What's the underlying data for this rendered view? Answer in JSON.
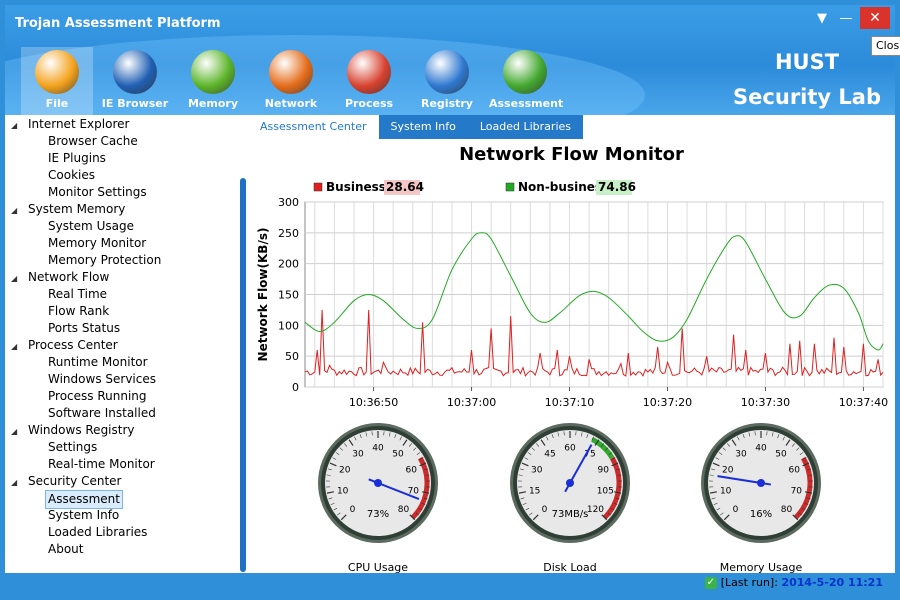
{
  "app": {
    "title": "Trojan Assessment Platform",
    "brand_line1": "HUST",
    "brand_line2": "Security Lab",
    "close_tooltip": "Clos"
  },
  "nav": [
    {
      "label": "File",
      "icon": "file-folder-icon",
      "color": "#f4a21c"
    },
    {
      "label": "IE Browser",
      "icon": "monitor-icon",
      "color": "#1f5fb3"
    },
    {
      "label": "Memory",
      "icon": "up-arrows-icon",
      "color": "#5cb52a"
    },
    {
      "label": "Network",
      "icon": "refresh-arrows-icon",
      "color": "#e46c1a"
    },
    {
      "label": "Process",
      "icon": "windows-tiles-icon",
      "color": "#d8422f"
    },
    {
      "label": "Registry",
      "icon": "shield-target-icon",
      "color": "#2e78d0"
    },
    {
      "label": "Assessment",
      "icon": "wrench-monitor-icon",
      "color": "#43a82f"
    }
  ],
  "sidebar": [
    {
      "label": "Internet Explorer",
      "level": 0
    },
    {
      "label": "Browser Cache",
      "level": 1
    },
    {
      "label": "IE Plugins",
      "level": 1
    },
    {
      "label": "Cookies",
      "level": 1
    },
    {
      "label": "Monitor Settings",
      "level": 1
    },
    {
      "label": "System Memory",
      "level": 0
    },
    {
      "label": "System Usage",
      "level": 1
    },
    {
      "label": "Memory Monitor",
      "level": 1
    },
    {
      "label": "Memory Protection",
      "level": 1
    },
    {
      "label": "Network Flow",
      "level": 0
    },
    {
      "label": "Real Time",
      "level": 1
    },
    {
      "label": "Flow Rank",
      "level": 1
    },
    {
      "label": "Ports Status",
      "level": 1
    },
    {
      "label": "Process Center",
      "level": 0
    },
    {
      "label": "Runtime Monitor",
      "level": 1
    },
    {
      "label": "Windows Services",
      "level": 1
    },
    {
      "label": "Process Running",
      "level": 1
    },
    {
      "label": "Software Installed",
      "level": 1
    },
    {
      "label": "Windows Registry",
      "level": 0
    },
    {
      "label": "Settings",
      "level": 1
    },
    {
      "label": "Real-time Monitor",
      "level": 1
    },
    {
      "label": "Security Center",
      "level": 0
    },
    {
      "label": "Assessment",
      "level": 1,
      "selected": true
    },
    {
      "label": "System Info",
      "level": 1
    },
    {
      "label": "Loaded Libraries",
      "level": 1
    },
    {
      "label": "About",
      "level": 1
    }
  ],
  "tabs": [
    {
      "label": "Assessment Center",
      "active": true
    },
    {
      "label": "System Info",
      "active": false
    },
    {
      "label": "Loaded Libraries",
      "active": false
    }
  ],
  "chart_data": {
    "type": "line",
    "title": "Network Flow Monitor",
    "ylabel": "Network Flow(KB/s)",
    "ylim": [
      0,
      300
    ],
    "yticks": [
      0,
      50,
      100,
      150,
      200,
      250,
      300
    ],
    "xticks": [
      "10:36:50",
      "10:37:00",
      "10:37:10",
      "10:37:20",
      "10:37:30",
      "10:37:40"
    ],
    "x_start_seconds": 43,
    "x_end_seconds": 102,
    "grid": true,
    "series": [
      {
        "name": "Business:",
        "current": "28.64",
        "color": "#e02020",
        "legend_bg": "#f5c6c6",
        "spikes": [
          [
            44.3,
            60
          ],
          [
            44.8,
            125
          ],
          [
            45.5,
            35
          ],
          [
            49.5,
            125
          ],
          [
            51,
            40
          ],
          [
            55,
            105
          ],
          [
            60,
            60
          ],
          [
            62,
            95
          ],
          [
            64,
            115
          ],
          [
            67,
            55
          ],
          [
            68.8,
            60
          ],
          [
            70,
            50
          ],
          [
            72,
            45
          ],
          [
            76,
            55
          ],
          [
            75.3,
            38
          ],
          [
            79,
            65
          ],
          [
            80,
            40
          ],
          [
            81.5,
            95
          ],
          [
            84,
            50
          ],
          [
            86.8,
            85
          ],
          [
            88,
            60
          ],
          [
            90,
            55
          ],
          [
            92.5,
            70
          ],
          [
            93.5,
            75
          ],
          [
            95,
            70
          ],
          [
            97,
            80
          ],
          [
            98,
            65
          ],
          [
            100,
            70
          ],
          [
            101.5,
            45
          ]
        ],
        "baseline": 18,
        "noise": 14
      },
      {
        "name": "Non-business:",
        "current": "74.86",
        "color": "#22aa22",
        "legend_bg": "#c8f0c8",
        "points": [
          [
            43,
            105
          ],
          [
            44.5,
            90
          ],
          [
            46,
            105
          ],
          [
            48,
            140
          ],
          [
            49.5,
            150
          ],
          [
            51,
            140
          ],
          [
            53,
            110
          ],
          [
            54.5,
            95
          ],
          [
            56,
            110
          ],
          [
            58,
            190
          ],
          [
            60,
            240
          ],
          [
            61,
            250
          ],
          [
            62,
            240
          ],
          [
            64,
            180
          ],
          [
            66,
            120
          ],
          [
            67.5,
            105
          ],
          [
            69,
            120
          ],
          [
            71,
            148
          ],
          [
            72.5,
            155
          ],
          [
            74,
            145
          ],
          [
            76,
            115
          ],
          [
            77.5,
            90
          ],
          [
            79,
            75
          ],
          [
            80.5,
            80
          ],
          [
            82,
            110
          ],
          [
            84,
            175
          ],
          [
            86,
            230
          ],
          [
            87,
            245
          ],
          [
            88,
            235
          ],
          [
            90,
            175
          ],
          [
            92,
            120
          ],
          [
            93.5,
            115
          ],
          [
            95,
            145
          ],
          [
            96.5,
            165
          ],
          [
            98,
            160
          ],
          [
            99.5,
            120
          ],
          [
            100.5,
            75
          ],
          [
            101.5,
            60
          ],
          [
            102,
            70
          ]
        ]
      }
    ]
  },
  "gauges": [
    {
      "label": "CPU Usage",
      "readout": "73%",
      "ticks": [
        "0",
        "10",
        "20",
        "30",
        "40",
        "50",
        "60",
        "70",
        "80"
      ],
      "min": 0,
      "max": 80,
      "value": 73,
      "has_green_arc": false
    },
    {
      "label": "Disk Load",
      "readout": "73MB/s",
      "ticks": [
        "0",
        "15",
        "30",
        "45",
        "60",
        "75",
        "90",
        "105",
        "120"
      ],
      "min": 0,
      "max": 120,
      "value": 73,
      "has_green_arc": true
    },
    {
      "label": "Memory Usage",
      "readout": "16%",
      "ticks": [
        "0",
        "10",
        "20",
        "30",
        "40",
        "50",
        "60",
        "70",
        "80"
      ],
      "min": 0,
      "max": 80,
      "value": 16,
      "has_green_arc": false
    }
  ],
  "status": {
    "label": "[Last run]:",
    "value": "2014-5-20 11:21"
  }
}
